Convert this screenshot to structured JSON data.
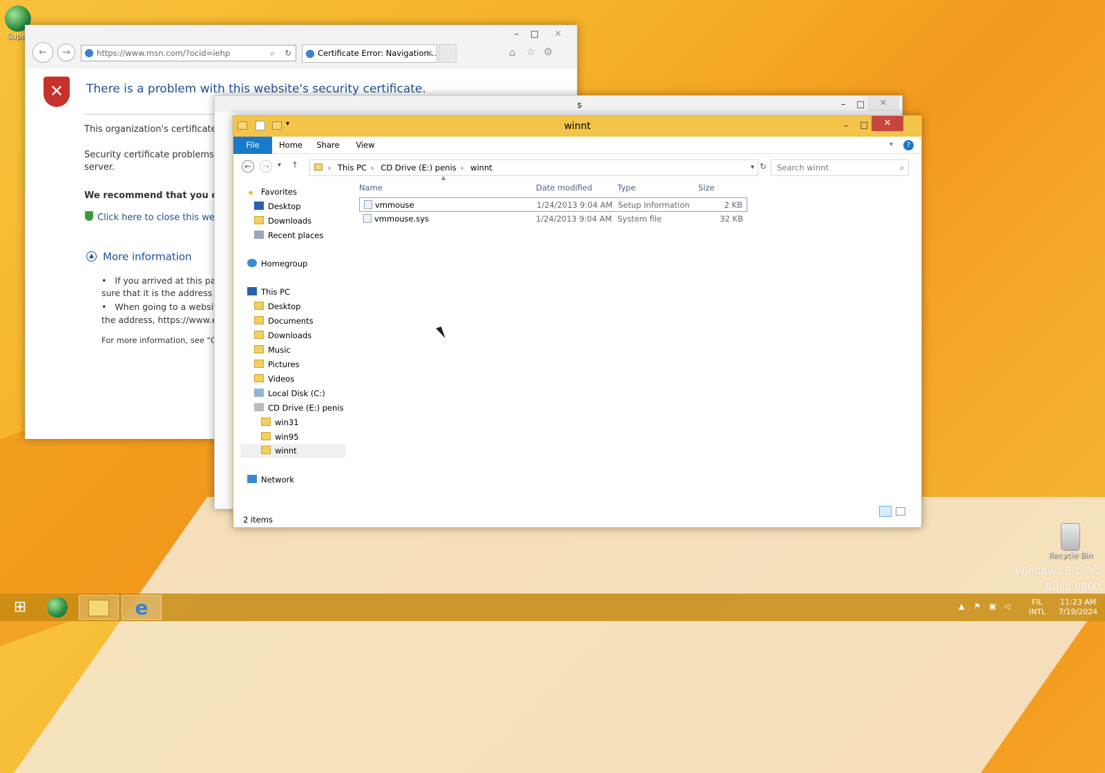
{
  "desktop": {
    "icon1_label": "Super",
    "recycle_label": "Recycle Bin",
    "watermark_line1": "Windows 8.1 Pro",
    "watermark_line2": "Build 9600"
  },
  "ie": {
    "url": "https://www.msn.com/?ocid=iehp",
    "tab_title": "Certificate Error: Navigation...",
    "heading": "There is a problem with this website's security certificate.",
    "para1": "This organization's certificate has",
    "para2a": "Security certificate problems may",
    "para2b": "server.",
    "recommend": "We recommend that you close t",
    "close_link": "Click here to close this webpag",
    "more_info": "More information",
    "bullet1a": "If you arrived at this page",
    "bullet1b": "sure that it is the address you",
    "bullet2a": "When going to a website w",
    "bullet2b": "the address, https://www.exar",
    "footer": "For more information, see \"Certif"
  },
  "bgwin": {
    "title_fragment": "s"
  },
  "explorer": {
    "title": "winnt",
    "tabs": [
      "File",
      "Home",
      "Share",
      "View"
    ],
    "breadcrumb": [
      "This PC",
      "CD Drive (E:) penis",
      "winnt"
    ],
    "search_placeholder": "Search winnt",
    "nav": {
      "favorites": "Favorites",
      "fav_items": [
        "Desktop",
        "Downloads",
        "Recent places"
      ],
      "homegroup": "Homegroup",
      "thispc": "This PC",
      "pc_items": [
        "Desktop",
        "Documents",
        "Downloads",
        "Music",
        "Pictures",
        "Videos",
        "Local Disk (C:)",
        "CD Drive (E:) penis"
      ],
      "cd_items": [
        "win31",
        "win95",
        "winnt"
      ],
      "network": "Network"
    },
    "columns": [
      "Name",
      "Date modified",
      "Type",
      "Size"
    ],
    "files": [
      {
        "name": "vmmouse",
        "date": "1/24/2013 9:04 AM",
        "type": "Setup Information",
        "size": "2 KB"
      },
      {
        "name": "vmmouse.sys",
        "date": "1/24/2013 9:04 AM",
        "type": "System file",
        "size": "32 KB"
      }
    ],
    "status": "2 items"
  },
  "taskbar": {
    "lang1": "FIL",
    "lang2": "INTL",
    "time": "11:23 AM",
    "date": "7/19/2024"
  }
}
